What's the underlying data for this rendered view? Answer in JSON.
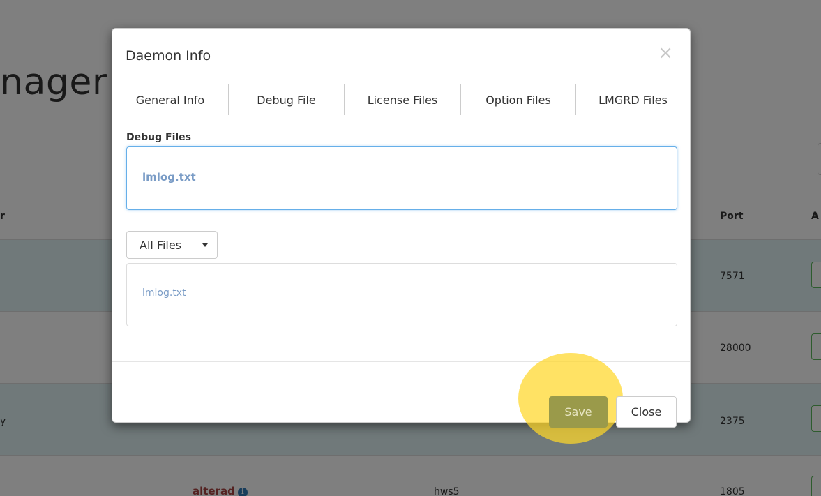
{
  "background": {
    "page_title": "nager",
    "table": {
      "header_left": "r",
      "header_port": "Port",
      "header_actions": "A",
      "rows": [
        {
          "left": "",
          "port": "7571"
        },
        {
          "left": "",
          "port": "28000"
        },
        {
          "left": "y",
          "port": "2375"
        },
        {
          "left": "",
          "port": "1805",
          "vendor": "alterad",
          "server": "hws5"
        }
      ]
    }
  },
  "modal": {
    "title": "Daemon Info",
    "close_symbol": "×",
    "tabs": [
      {
        "label": "General Info"
      },
      {
        "label": "Debug File"
      },
      {
        "label": "License Files"
      },
      {
        "label": "Option Files"
      },
      {
        "label": "LMGRD Files"
      }
    ],
    "debug_files_label": "Debug Files",
    "debug_files": [
      "lmlog.txt"
    ],
    "filter": {
      "selected": "All Files"
    },
    "file_list": [
      "lmlog.txt"
    ],
    "buttons": {
      "save": "Save",
      "close": "Close"
    }
  },
  "colors": {
    "save_button": "#9a9a4a",
    "highlight": "#ffd728",
    "row_highlight": "#e1f2f4",
    "link": "#7a9cc6"
  },
  "icons": {
    "info": "info-circle-icon",
    "caret": "caret-down-icon",
    "close": "close-icon"
  }
}
